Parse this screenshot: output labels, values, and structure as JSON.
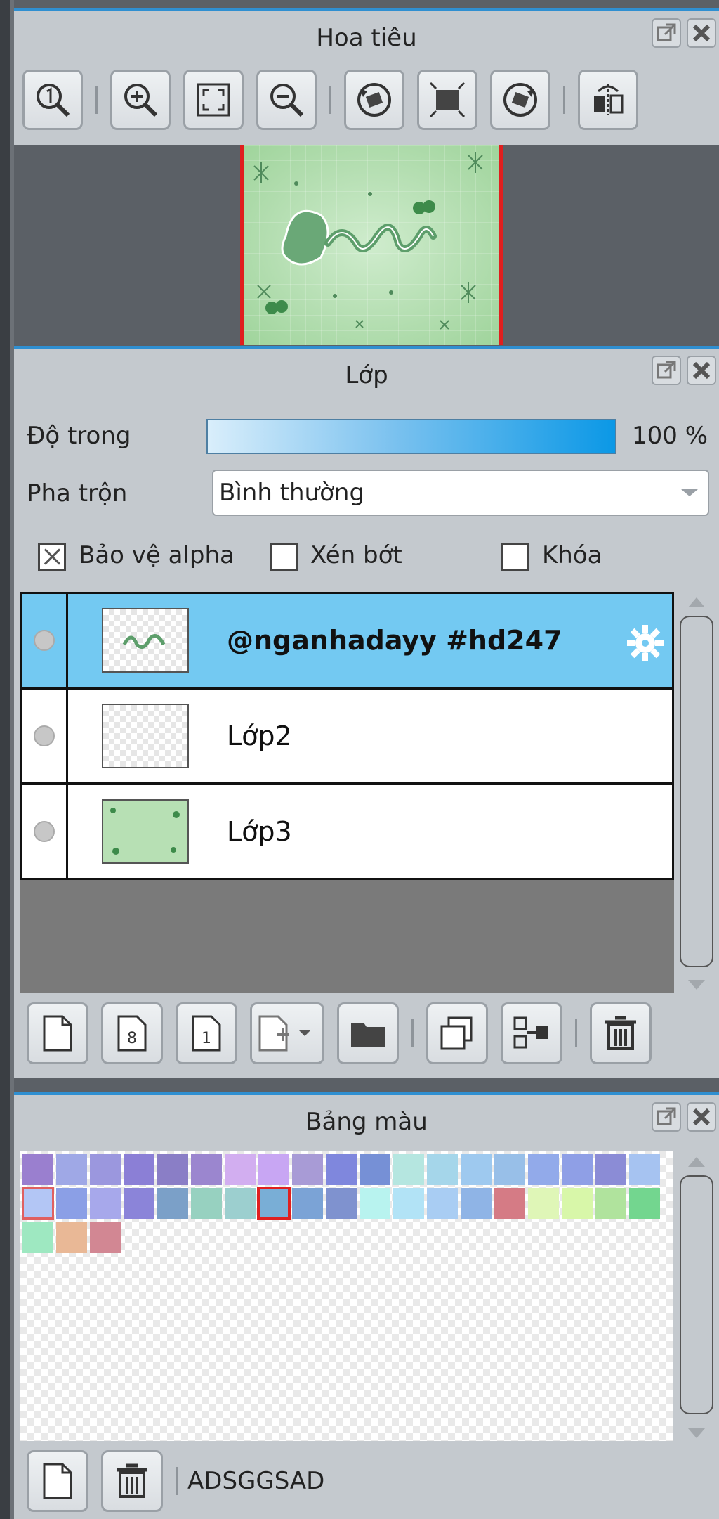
{
  "navigator": {
    "title": "Hoa tiêu",
    "tools": [
      {
        "name": "zoom-actual-size-icon"
      },
      {
        "name": "zoom-in-icon"
      },
      {
        "name": "fit-window-icon"
      },
      {
        "name": "zoom-out-icon"
      },
      {
        "name": "rotate-left-icon"
      },
      {
        "name": "reset-view-icon"
      },
      {
        "name": "rotate-right-icon"
      },
      {
        "name": "flip-horizontal-icon"
      }
    ]
  },
  "layer": {
    "title": "Lớp",
    "opacity_label": "Độ trong",
    "opacity_value": "100 %",
    "opacity_fraction": 1.0,
    "blend_label": "Pha trộn",
    "blend_value": "Bình thường",
    "protect_alpha_label": "Bảo vệ alpha",
    "protect_alpha_checked": true,
    "clipping_label": "Xén bớt",
    "clipping_checked": false,
    "lock_label": "Khóa",
    "lock_checked": false,
    "layers": [
      {
        "name": "@nganhadayy #hd247",
        "selected": true
      },
      {
        "name": "Lớp2",
        "selected": false
      },
      {
        "name": "Lớp3",
        "selected": false
      }
    ]
  },
  "palette": {
    "title": "Bảng màu",
    "name": "ADSGGSAD",
    "colors_row1": [
      "#9a7fcf",
      "#9fa8e6",
      "#9b97de",
      "#8b7fd6",
      "#8a7ec6",
      "#9b86cf",
      "#d2aef0",
      "#c8a6f3",
      "#a89bd6",
      "#7f87dd",
      "#7690d6",
      "#b5e6e0",
      "#a5d6ea",
      "#9ec9ef",
      "#98bfe8",
      "#92aaea",
      "#8f9fe6",
      "#8b8cd6",
      "#a6c3f1"
    ],
    "colors_row2": [
      "#b3c6f5",
      "#8b9fe6",
      "#a7a8eb",
      "#8b84d9",
      "#7ba0c8",
      "#97d1c0",
      "#9ccfcf",
      "#79aed6",
      "#7ba3d6",
      "#7f92cf",
      "#b8f3ef",
      "#b2e3f6",
      "#a9cdf3",
      "#8fb4e6",
      "#d57b85",
      "#dff6b7",
      "#d8f7a9",
      "#b0e39d",
      "#73d68f"
    ],
    "colors_row3": [
      "#9ee8c1",
      "#e9b896",
      "#d28793"
    ]
  }
}
